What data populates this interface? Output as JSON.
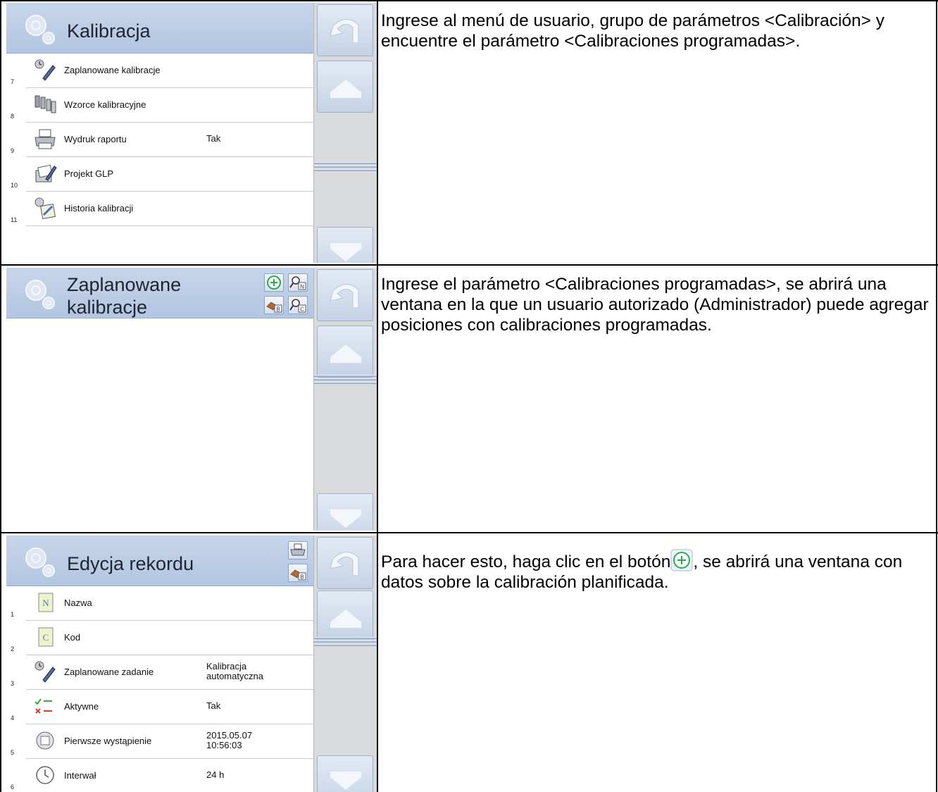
{
  "screen1": {
    "title": "Kalibracja",
    "rows": [
      {
        "num": "7",
        "icon": "scheduled-calibration-icon",
        "label": "Zaplanowane kalibracje",
        "value": ""
      },
      {
        "num": "8",
        "icon": "calibration-weights-icon",
        "label": "Wzorce kalibracyjne",
        "value": ""
      },
      {
        "num": "9",
        "icon": "printer-icon",
        "label": "Wydruk raportu",
        "value": "Tak"
      },
      {
        "num": "10",
        "icon": "glp-project-icon",
        "label": "Projekt GLP",
        "value": ""
      },
      {
        "num": "11",
        "icon": "calibration-history-icon",
        "label": "Historia kalibracji",
        "value": ""
      }
    ],
    "description": "Ingrese al menú de usuario, grupo de parámetros <Calibración> y encuentre el parámetro <Calibraciones programadas>."
  },
  "screen2": {
    "title_line1": "Zaplanowane",
    "title_line2": "kalibracje",
    "toolbar_icons": [
      "add-icon",
      "search-by-name-icon",
      "export-icon",
      "search-by-code-icon"
    ],
    "toolbar_badges": {
      "name": "N",
      "code": "C",
      "export": "B"
    },
    "description": "Ingrese el parámetro <Calibraciones programadas>, se abrirá una ventana en la que un usuario autorizado (Administrador) puede agregar posiciones con calibraciones programadas."
  },
  "screen3": {
    "title": "Edycja rekordu",
    "toolbar_icons": [
      "printer-icon",
      "export-icon"
    ],
    "toolbar_badges": {
      "export": "B"
    },
    "rows": [
      {
        "num": "1",
        "icon": "name-field-icon",
        "label": "Nazwa",
        "value_line1": "",
        "value_line2": ""
      },
      {
        "num": "2",
        "icon": "code-field-icon",
        "label": "Kod",
        "value_line1": "",
        "value_line2": ""
      },
      {
        "num": "3",
        "icon": "scheduled-task-icon",
        "label": "Zaplanowane zadanie",
        "value_line1": "Kalibracja",
        "value_line2": "automatyczna"
      },
      {
        "num": "4",
        "icon": "active-toggle-icon",
        "label": "Aktywne",
        "value_line1": "Tak",
        "value_line2": ""
      },
      {
        "num": "5",
        "icon": "first-occurrence-icon",
        "label": "Pierwsze wystąpienie",
        "value_line1": "2015.05.07",
        "value_line2": "10:56:03"
      },
      {
        "num": "6",
        "icon": "clock-icon",
        "label": "Interwał",
        "value_line1": "24 h",
        "value_line2": ""
      }
    ],
    "description_before": "Para hacer esto, haga clic en el botón",
    "description_after": ", se abrirá una ventana con datos sobre la calibración planificada."
  },
  "colors": {
    "title_bar": "#b9cae3",
    "panel": "#d9dadc",
    "accent_green": "#22b14c"
  }
}
